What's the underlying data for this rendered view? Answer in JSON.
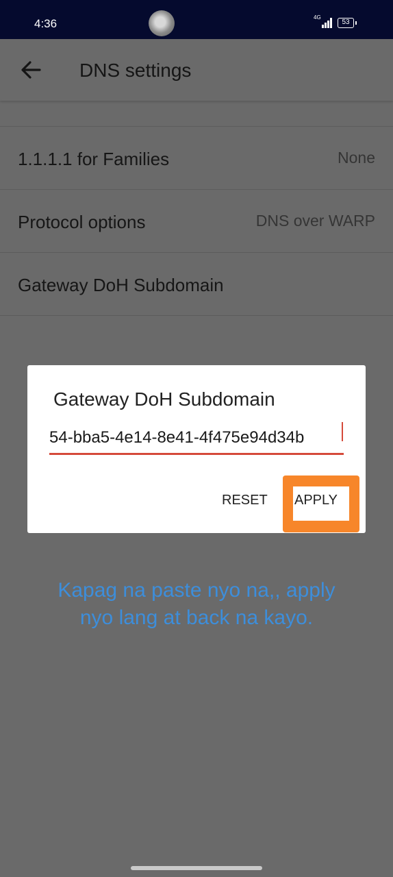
{
  "status_bar": {
    "time": "4:36",
    "network": "4G",
    "battery": "53"
  },
  "app_bar": {
    "back_icon": "arrow-left-icon",
    "title": "DNS settings"
  },
  "settings": [
    {
      "title": "1.1.1.1 for Families",
      "value": "None"
    },
    {
      "title": "Protocol options",
      "value": "DNS over WARP"
    },
    {
      "title": "Gateway DoH Subdomain",
      "value": ""
    }
  ],
  "dialog": {
    "title": "Gateway DoH Subdomain",
    "input_value": "54-bba5-4e14-8e41-4f475e94d34b",
    "reset_label": "RESET",
    "apply_label": "APPLY",
    "highlight_color": "#f7862a"
  },
  "annotation": {
    "text": "Kapag na paste nyo na,, apply nyo lang at back na kayo.",
    "color": "#3d8edb"
  }
}
